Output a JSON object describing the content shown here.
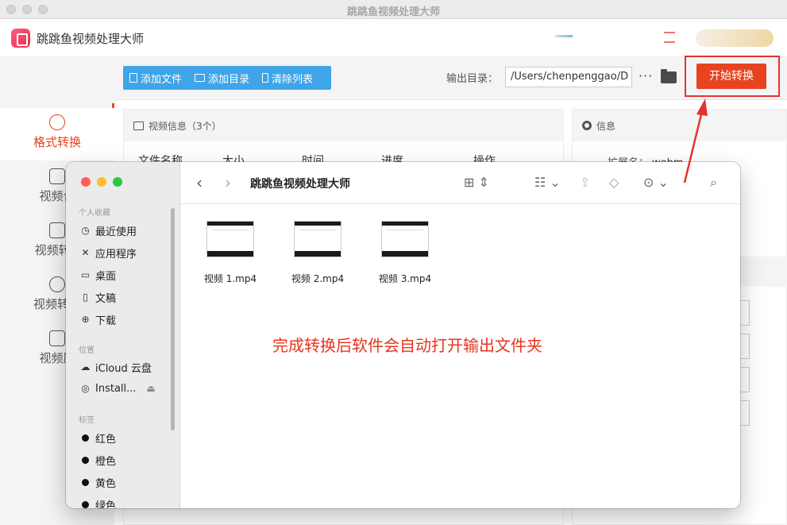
{
  "window": {
    "title": "跳跳鱼视频处理大师"
  },
  "app": {
    "name": "跳跳鱼视频处理大师"
  },
  "sidebar": {
    "items": [
      {
        "label": "格式转换"
      },
      {
        "label": "视频合"
      },
      {
        "label": "视频转G"
      },
      {
        "label": "视频转音"
      },
      {
        "label": "视频压"
      }
    ]
  },
  "toolbar": {
    "add_file": "添加文件",
    "add_dir": "添加目录",
    "clear_list": "清除列表",
    "output_label": "输出目录：",
    "output_path": "/Users/chenpenggao/D",
    "more": "···",
    "start": "开始转换"
  },
  "video_panel": {
    "title": "视频信息（3个）",
    "columns": [
      "文件名称",
      "大小",
      "时间",
      "进度",
      "操作"
    ]
  },
  "info_panel": {
    "title": "信息",
    "ext_label": "扩展名：",
    "ext_value": "webm"
  },
  "finder": {
    "title": "跳跳鱼视频处理大师",
    "sections": {
      "favorites": "个人收藏",
      "locations": "位置",
      "tags": "标签"
    },
    "favorites": [
      "最近使用",
      "应用程序",
      "桌面",
      "文稿",
      "下载"
    ],
    "locations": [
      "iCloud 云盘",
      "Install..."
    ],
    "tags": [
      "红色",
      "橙色",
      "黄色",
      "绿色"
    ],
    "files": [
      "视频 1.mp4",
      "视频 2.mp4",
      "视频 3.mp4"
    ],
    "notice": "完成转换后软件会自动打开输出文件夹"
  },
  "colors": {
    "accent": "#e8431f",
    "toolbar_blue": "#3fa5e8",
    "annotation": "#e83030"
  }
}
